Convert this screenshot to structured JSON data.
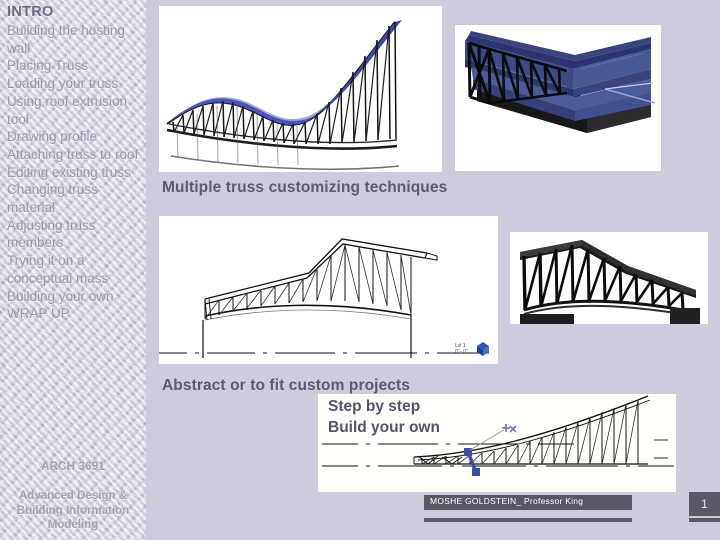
{
  "slide": {
    "background_color": "#cfcbdd",
    "page_number": "1"
  },
  "sidebar": {
    "title": "INTRO",
    "items": [
      "Building the hosting wall",
      "Placing Truss",
      "Loading your truss",
      "Using roof extrusion tool",
      "Drawing profile",
      "Attaching truss to roof",
      "Editing existing truss",
      "Changing truss material",
      "Adjusting truss members",
      "Trying it on a conceptual mass",
      "Building your own",
      "WRAP UP"
    ],
    "course_code": "ARCH 3691",
    "program": "Advanced Design & Building Information Modeling"
  },
  "main": {
    "caption_top": "Multiple truss customizing techniques",
    "caption_bottom": "Abstract or to fit custom projects",
    "panel": {
      "line1": "Step by step",
      "line2": "Build your own"
    },
    "images": [
      {
        "name": "curved-blue-truss-render",
        "alt": "Curved wave-shaped roof truss with blue surface"
      },
      {
        "name": "building-blue-roof-render",
        "alt": "3D building with blue pitched roof over dark mass"
      },
      {
        "name": "truss-elevation-wireframe",
        "alt": "Wireframe elevation of sloped truss on wall"
      },
      {
        "name": "dark-truss-render",
        "alt": "Dark shaded 3D truss with curved bottom chord"
      },
      {
        "name": "truss-edit-diagram",
        "alt": "Truss profile diagram with dash-dot reference lines and drag handles"
      }
    ]
  },
  "footer": {
    "author": "MOSHE GOLDSTEIN_ Professor King"
  },
  "colors": {
    "background": "#cfcbdd",
    "sidebar_text": "#9b98ae",
    "heading_text": "#6e6b84",
    "caption_text": "#5d5a72",
    "footer_bar": "#5a5766",
    "roof_blue": "#3b45a8",
    "handle_blue": "#3a4da8"
  }
}
